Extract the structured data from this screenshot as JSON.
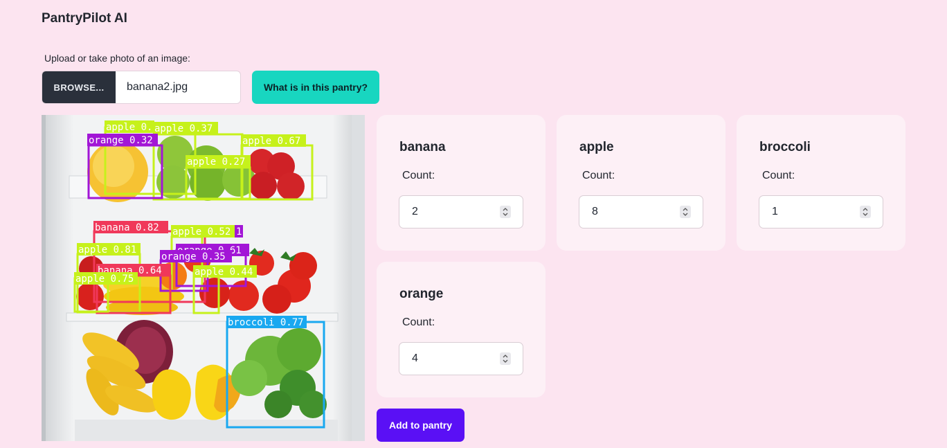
{
  "app": {
    "title": "PantryPilot AI"
  },
  "upload": {
    "label": "Upload or take photo of an image:",
    "browse_label": "BROWSE...",
    "file_name": "banana2.jpg",
    "analyze_label": "What is in this pantry?"
  },
  "detections": [
    {
      "label": "apple 0.39",
      "color": "#c6f11b"
    },
    {
      "label": "apple 0.37",
      "color": "#c6f11b"
    },
    {
      "label": "orange 0.32",
      "color": "#a216d6"
    },
    {
      "label": "apple 0.67",
      "color": "#c6f11b"
    },
    {
      "label": "apple 0.27",
      "color": "#c6f11b"
    },
    {
      "label": "banana 0.82",
      "color": "#f0385a"
    },
    {
      "label": "apple 0.52",
      "color": "#c6f11b"
    },
    {
      "label": "1",
      "color": "#a216d6"
    },
    {
      "label": "apple 0.81",
      "color": "#c6f11b"
    },
    {
      "label": "orange 0.61",
      "color": "#a216d6"
    },
    {
      "label": "orange 0.35",
      "color": "#a216d6"
    },
    {
      "label": "banana 0.64",
      "color": "#f0385a"
    },
    {
      "label": "apple 0.44",
      "color": "#c6f11b"
    },
    {
      "label": "apple 0.75",
      "color": "#c6f11b"
    },
    {
      "label": "broccoli 0.77",
      "color": "#19a8f0"
    }
  ],
  "items": [
    {
      "name": "banana",
      "count_label": "Count:",
      "count": "2"
    },
    {
      "name": "apple",
      "count_label": "Count:",
      "count": "8"
    },
    {
      "name": "broccoli",
      "count_label": "Count:",
      "count": "1"
    },
    {
      "name": "orange",
      "count_label": "Count:",
      "count": "4"
    }
  ],
  "actions": {
    "add_label": "Add to pantry"
  },
  "colors": {
    "accent": "#5a10f5",
    "analyze": "#18d6c0",
    "background": "#fce4f0",
    "browse": "#2a303b"
  }
}
